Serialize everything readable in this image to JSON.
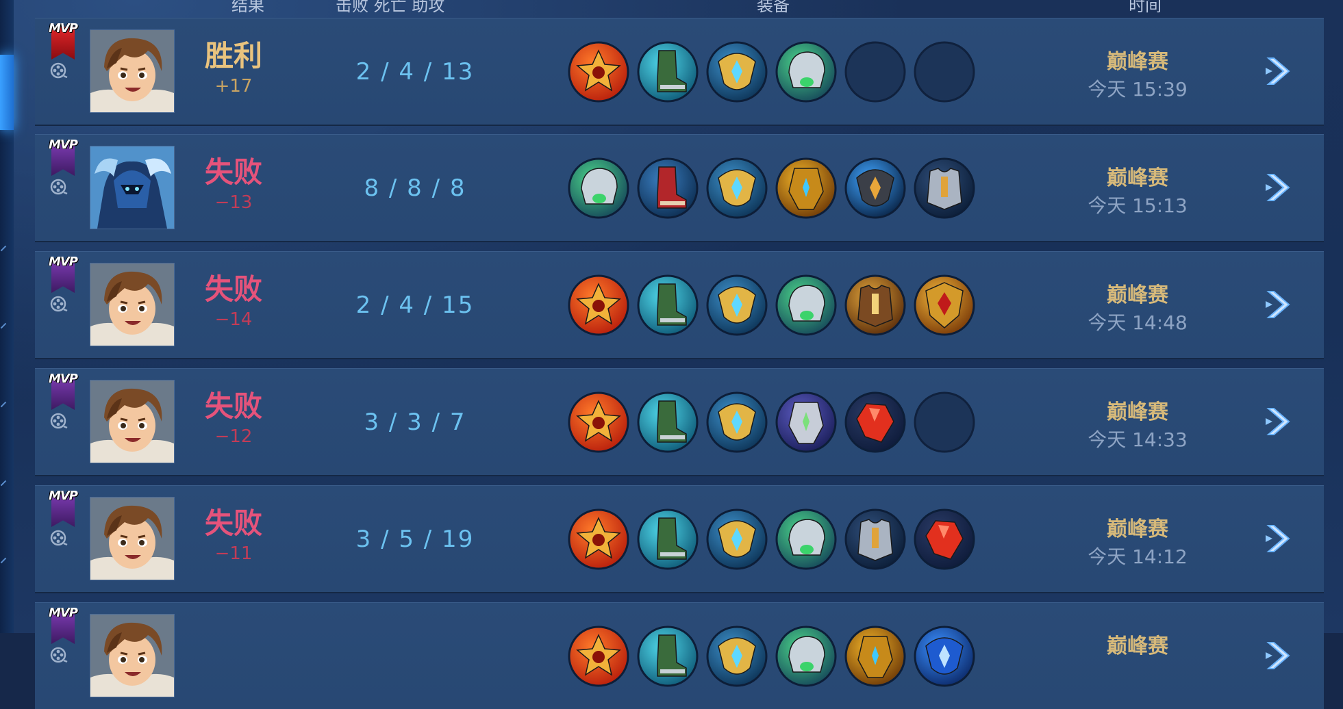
{
  "header": {
    "col_result": "结果",
    "col_kda": "击败 死亡 助攻",
    "col_items": "装备",
    "col_time": "时间"
  },
  "colors": {
    "win": "#e9c37e",
    "loss": "#e5537b",
    "loss_delta": "#c23c57",
    "kda": "#6cc2f0",
    "mode": "#d6b97a"
  },
  "matches": [
    {
      "mvp_label": "MVP",
      "mvp_color": "red",
      "hero": "hero-boy-portrait",
      "result": "胜利",
      "delta": "+17",
      "kda": "2 / 4 / 13",
      "items": [
        "fire-orb-icon",
        "green-boots-icon",
        "gold-blue-crest-icon",
        "silver-green-helm-icon",
        "empty",
        "empty"
      ],
      "mode": "巅峰赛",
      "time": "今天 15:39"
    },
    {
      "mvp_label": "MVP",
      "mvp_color": "purple",
      "hero": "hero-blue-armor-portrait",
      "result": "失败",
      "delta": "−13",
      "kda": "8 / 8 / 8",
      "items": [
        "silver-green-helm-icon",
        "red-armor-boots-icon",
        "gold-blue-crest-icon",
        "gold-mask-icon",
        "dark-gauntlet-icon",
        "steel-chestplate-icon"
      ],
      "mode": "巅峰赛",
      "time": "今天 15:13"
    },
    {
      "mvp_label": "MVP",
      "mvp_color": "purple",
      "hero": "hero-boy-portrait",
      "result": "失败",
      "delta": "−14",
      "kda": "2 / 4 / 15",
      "items": [
        "fire-orb-icon",
        "green-boots-icon",
        "gold-blue-crest-icon",
        "silver-green-helm-icon",
        "bronze-claw-armor-icon",
        "gold-red-shield-icon"
      ],
      "mode": "巅峰赛",
      "time": "今天 14:48"
    },
    {
      "mvp_label": "MVP",
      "mvp_color": "purple",
      "hero": "hero-boy-portrait",
      "result": "失败",
      "delta": "−12",
      "kda": "3 / 3 / 7",
      "items": [
        "fire-orb-icon",
        "green-boots-icon",
        "gold-blue-crest-icon",
        "silver-purple-mask-icon",
        "red-crystal-icon",
        "empty"
      ],
      "mode": "巅峰赛",
      "time": "今天 14:33"
    },
    {
      "mvp_label": "MVP",
      "mvp_color": "purple",
      "hero": "hero-boy-portrait",
      "result": "失败",
      "delta": "−11",
      "kda": "3 / 5 / 19",
      "items": [
        "fire-orb-icon",
        "green-boots-icon",
        "gold-blue-crest-icon",
        "silver-green-helm-icon",
        "steel-chestplate-icon",
        "red-crystal-icon"
      ],
      "mode": "巅峰赛",
      "time": "今天 14:12"
    },
    {
      "mvp_label": "MVP",
      "mvp_color": "purple",
      "hero": "hero-boy-portrait",
      "result": "",
      "delta": "",
      "kda": "",
      "items": [
        "fire-orb-icon",
        "green-boots-icon",
        "gold-blue-crest-icon",
        "silver-green-helm-icon",
        "gold-mask-icon",
        "blue-orb-icon"
      ],
      "mode": "巅峰赛",
      "time": ""
    }
  ]
}
